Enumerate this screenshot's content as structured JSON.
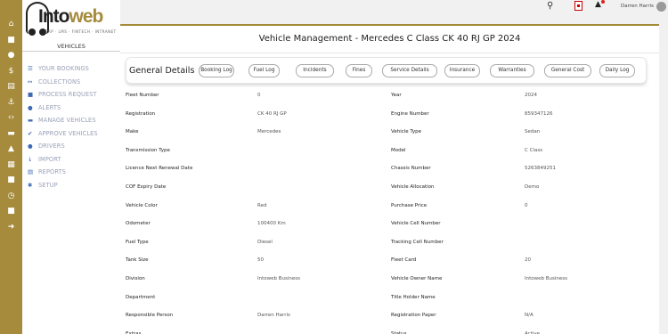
{
  "app": {
    "logo": "Intoweb",
    "logo_first": "Into",
    "logo_second": "web",
    "tagline": "ERP · LMS · FINTECH · INTRANET",
    "section": "VEHICLES"
  },
  "topbar": {
    "user": "Darren Harris"
  },
  "rail_icons": [
    "home-icon",
    "building-icon",
    "users-icon",
    "dollar-icon",
    "file-icon",
    "anchor-icon",
    "code-icon",
    "car-icon",
    "graduation-icon",
    "calendar-icon",
    "folder-icon",
    "clock-icon",
    "lock-icon",
    "signout-icon"
  ],
  "menu": [
    {
      "label": "YOUR BOOKINGS",
      "icon": "list-icon",
      "glyph": "☰"
    },
    {
      "label": "COLLECTIONS",
      "icon": "arrows-icon",
      "glyph": "↔"
    },
    {
      "label": "PROCESS REQUEST",
      "icon": "folder-icon",
      "glyph": "■"
    },
    {
      "label": "ALERTS",
      "icon": "bell-icon",
      "glyph": "●"
    },
    {
      "label": "MANAGE VEHICLES",
      "icon": "car-icon",
      "glyph": "▬"
    },
    {
      "label": "APPROVE VEHICLES",
      "icon": "check-circle-icon",
      "glyph": "✔"
    },
    {
      "label": "DRIVERS",
      "icon": "user-icon",
      "glyph": "●"
    },
    {
      "label": "IMPORT",
      "icon": "download-icon",
      "glyph": "↓"
    },
    {
      "label": "REPORTS",
      "icon": "report-icon",
      "glyph": "▤"
    },
    {
      "label": "SETUP",
      "icon": "gear-icon",
      "glyph": "✱"
    }
  ],
  "page": {
    "title": "Vehicle Management - Mercedes C Class CK 40 RJ GP 2024",
    "section_title": "General Details",
    "buttons": [
      "Booking Log",
      "Fuel Log",
      "Incidents",
      "Fines",
      "Service Details",
      "Insurance",
      "Warranties",
      "General Cost",
      "Daily Log"
    ]
  },
  "details": [
    {
      "l1": "Fleet Number",
      "v1": "0",
      "l2": "Year",
      "v2": "2024"
    },
    {
      "l1": "Registration",
      "v1": "CK 40 RJ GP",
      "l2": "Engine Number",
      "v2": "859347126"
    },
    {
      "l1": "Make",
      "v1": "Mercedes",
      "l2": "Vehicle Type",
      "v2": "Sedan"
    },
    {
      "l1": "Transmission Type",
      "v1": "",
      "l2": "Model",
      "v2": "C Class"
    },
    {
      "l1": "Licence Next Renewal Date",
      "v1": "",
      "l2": "Chassis Number",
      "v2": "5263849251"
    },
    {
      "l1": "COF Expiry Date",
      "v1": "",
      "l2": "Vehicle Allocation",
      "v2": "Demo"
    },
    {
      "l1": "Vehicle Color",
      "v1": "Red",
      "l2": "Purchase Price",
      "v2": "0"
    },
    {
      "l1": "Odometer",
      "v1": "100400 Km",
      "l2": "Vehicle Cell Number",
      "v2": ""
    },
    {
      "l1": "Fuel Type",
      "v1": "Diesel",
      "l2": "Tracking Cell Number",
      "v2": ""
    },
    {
      "l1": "Tank Size",
      "v1": "50",
      "l2": "Fleet Card",
      "v2": "20"
    },
    {
      "l1": "Division",
      "v1": "Intoweb Business",
      "l2": "Vehicle Owner Name",
      "v2": "Intoweb Business"
    },
    {
      "l1": "Department",
      "v1": "",
      "l2": "Title Holder Name",
      "v2": ""
    },
    {
      "l1": "Responsible Person",
      "v1": "Darren Harris",
      "l2": "Registration Paper",
      "v2": "N/A"
    },
    {
      "l1": "Extras",
      "v1": "",
      "l2": "Status",
      "v2": "Active"
    }
  ],
  "colors": {
    "brand": "#a68b3c",
    "menu_text": "#9aa1b8",
    "menu_icon": "#3f6ab3"
  }
}
